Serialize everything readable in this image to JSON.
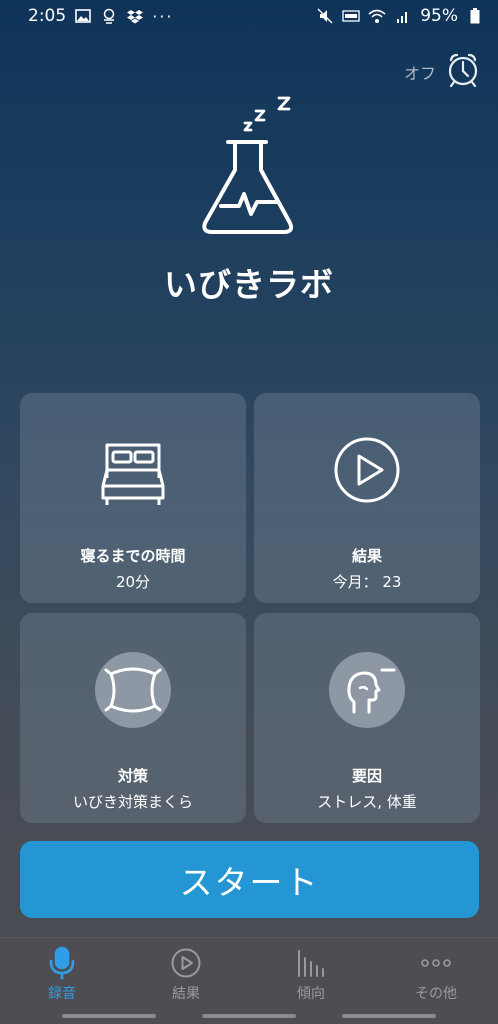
{
  "status_bar": {
    "time": "2:05",
    "left_icons": [
      "image-icon",
      "data-saver-icon",
      "dropbox-icon"
    ],
    "more": "···",
    "right_icons": [
      "mute-icon",
      "volte-icon",
      "wifi-icon",
      "signal-icon"
    ],
    "battery": "95%"
  },
  "alarm": {
    "label": "オフ",
    "icon": "alarm-clock-icon"
  },
  "hero": {
    "logo_icon": "flask-heartbeat-icon",
    "sleep_icon": "zzz-icon",
    "title": "いびきラボ"
  },
  "tiles": [
    {
      "icon": "bed-icon",
      "title": "寝るまでの時間",
      "value": "20分"
    },
    {
      "icon": "play-circle-icon",
      "title": "結果",
      "value": "今月： 23"
    },
    {
      "icon": "pillow-icon",
      "title": "対策",
      "value": "いびき対策まくら"
    },
    {
      "icon": "head-profile-icon",
      "title": "要因",
      "value": "ストレス, 体重"
    }
  ],
  "start_button": {
    "label": "スタート"
  },
  "bottom_nav": {
    "items": [
      {
        "icon": "microphone-icon",
        "label": "録音",
        "active": true
      },
      {
        "icon": "play-circle-icon",
        "label": "結果",
        "active": false
      },
      {
        "icon": "bar-chart-icon",
        "label": "傾向",
        "active": false
      },
      {
        "icon": "more-icon",
        "label": "その他",
        "active": false
      }
    ]
  },
  "colors": {
    "accent": "#2496d3",
    "active_nav": "#2f9ee6",
    "inactive_nav": "#9a9a9e",
    "tile_bg": "#5d6b7c"
  }
}
